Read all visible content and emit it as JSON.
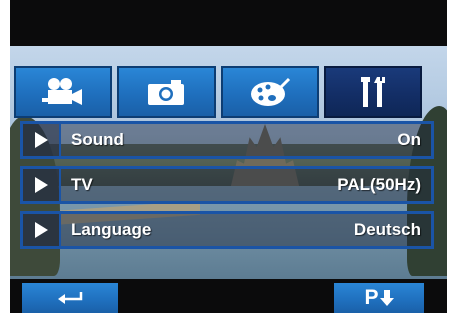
{
  "tabs": [
    {
      "icon": "movie-camera-icon",
      "active": false
    },
    {
      "icon": "camera-icon",
      "active": false
    },
    {
      "icon": "palette-icon",
      "active": false
    },
    {
      "icon": "tools-icon",
      "active": true
    }
  ],
  "menu": {
    "items": [
      {
        "label": "Sound",
        "value": "On"
      },
      {
        "label": "TV",
        "value": "PAL(50Hz)"
      },
      {
        "label": "Language",
        "value": "Deutsch"
      }
    ]
  },
  "bottom": {
    "back_icon": "return-arrow-icon",
    "page_label": "P",
    "page_icon": "down-arrow-icon"
  },
  "colors": {
    "tab_blue": "#1f6fbd",
    "tab_active": "#132e66",
    "row_border": "#1a54a6"
  }
}
